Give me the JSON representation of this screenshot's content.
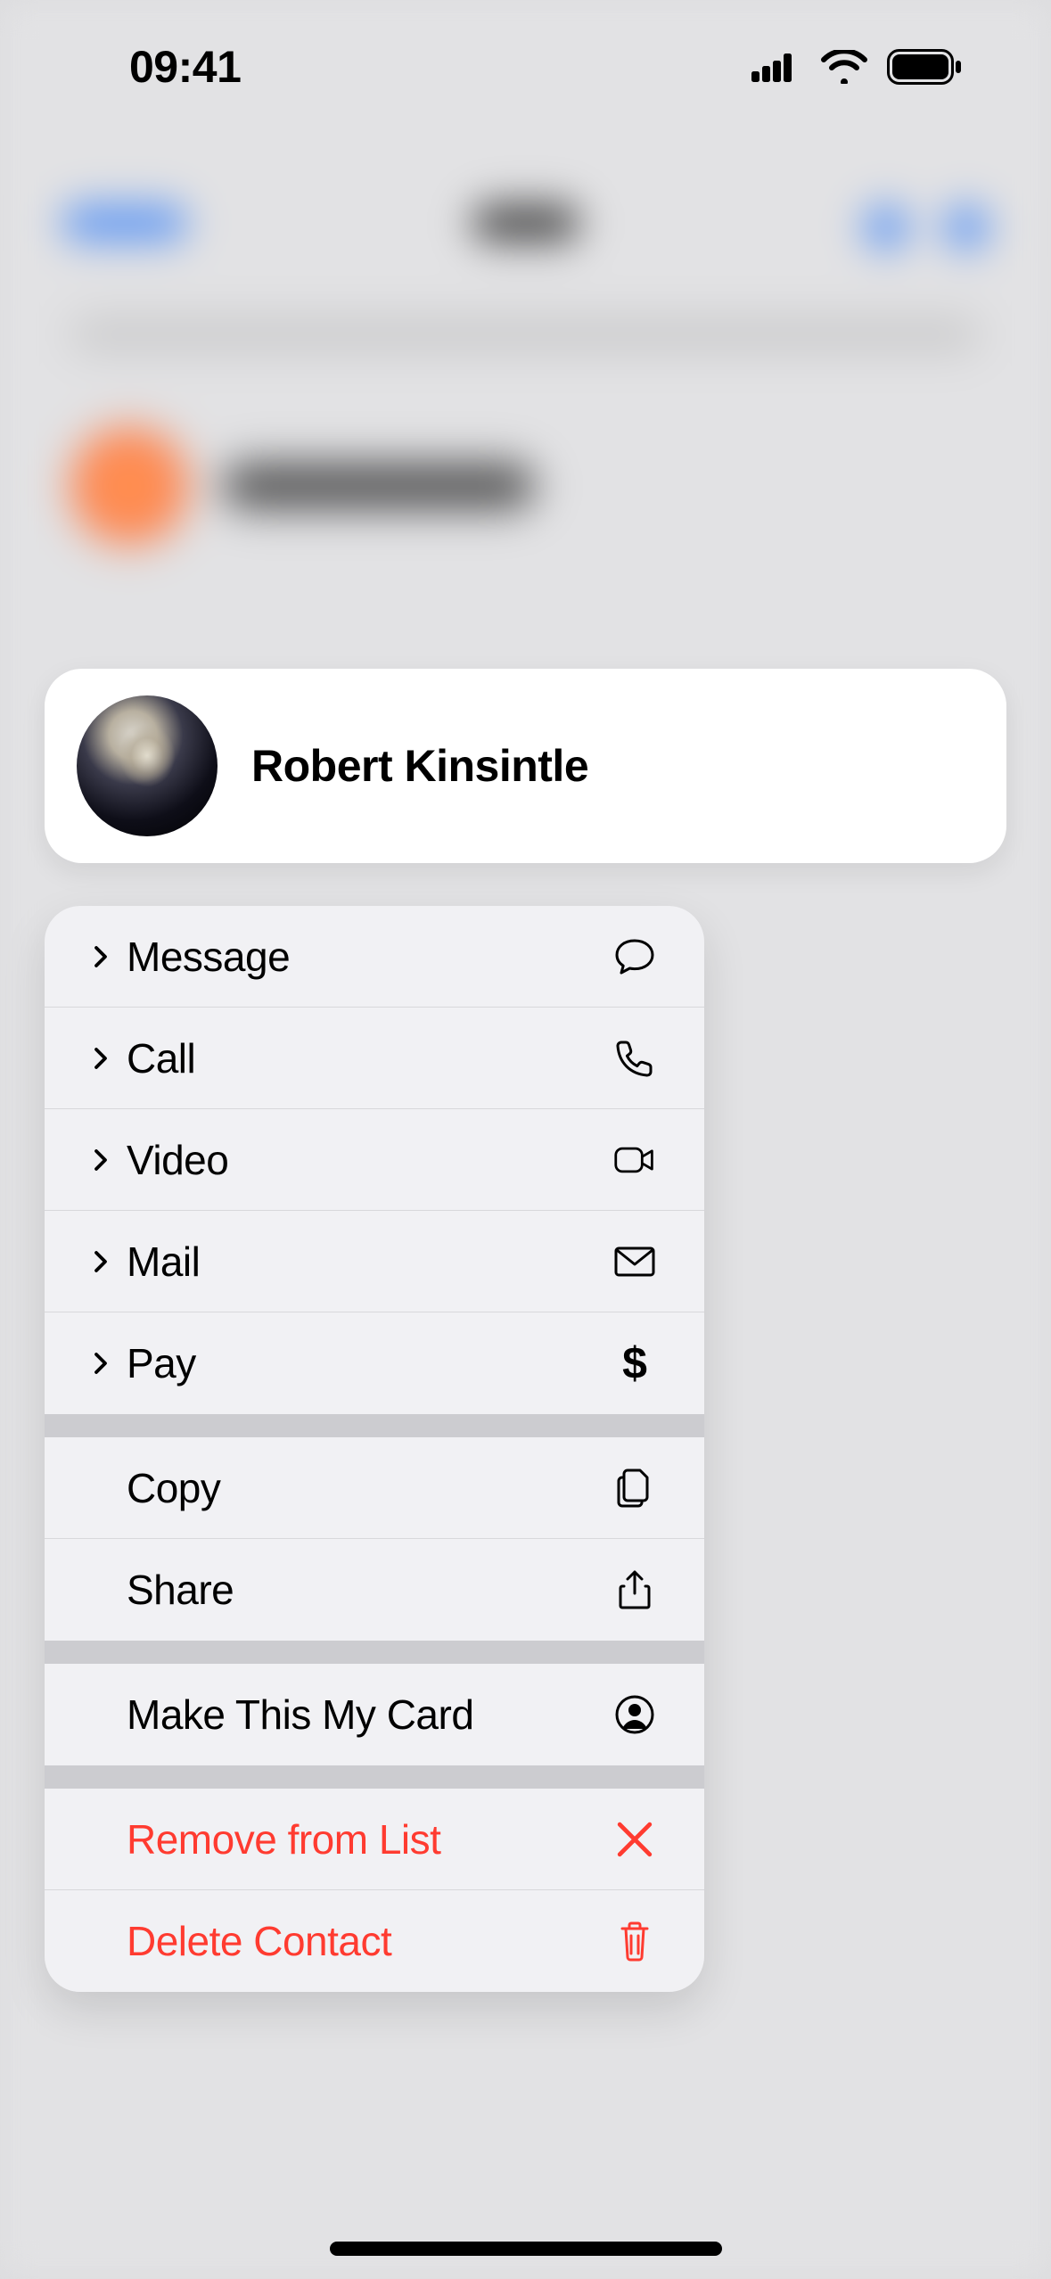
{
  "status": {
    "time": "09:41"
  },
  "contact": {
    "name": "Robert Kinsintle"
  },
  "menu": {
    "message": "Message",
    "call": "Call",
    "video": "Video",
    "mail": "Mail",
    "pay": "Pay",
    "copy": "Copy",
    "share": "Share",
    "make_card": "Make This My Card",
    "remove": "Remove from List",
    "delete": "Delete Contact"
  },
  "colors": {
    "destructive": "#ff3b30"
  }
}
